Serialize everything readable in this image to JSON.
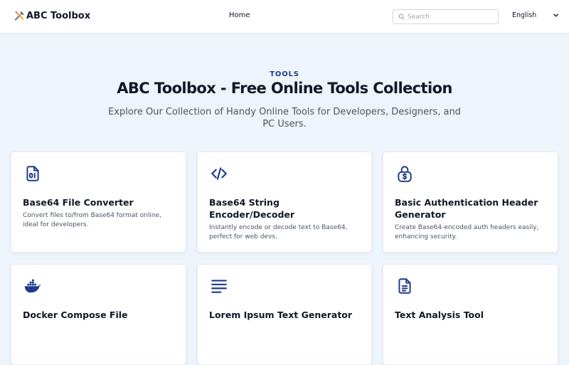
{
  "header": {
    "logo_text": "ABC Toolbox",
    "nav": {
      "home_label": "Home"
    },
    "search": {
      "placeholder": "Search"
    },
    "language": {
      "selected": "English"
    }
  },
  "hero": {
    "eyebrow": "TOOLS",
    "title": "ABC Toolbox - Free Online Tools Collection",
    "subtitle": "Explore Our Collection of Handy Online Tools for Developers, Designers, and PC Users."
  },
  "colors": {
    "accent": "#1e3a8a",
    "background": "#eef4fb",
    "card": "#ffffff"
  },
  "tools": [
    {
      "icon": "file-binary-icon",
      "title": "Base64 File Converter",
      "description": "Convert files to/from Base64 format online, ideal for developers."
    },
    {
      "icon": "code-icon",
      "title": "Base64 String Encoder/Decoder",
      "description": "Instantly encode or decode text to Base64, perfect for web devs."
    },
    {
      "icon": "lock-dollar-icon",
      "title": "Basic Authentication Header Generator",
      "description": "Create Base64-encoded auth headers easily, enhancing security."
    },
    {
      "icon": "docker-icon",
      "title": "Docker Compose File",
      "description": ""
    },
    {
      "icon": "text-lines-icon",
      "title": "Lorem Ipsum Text Generator",
      "description": ""
    },
    {
      "icon": "document-icon",
      "title": "Text Analysis Tool",
      "description": ""
    }
  ]
}
